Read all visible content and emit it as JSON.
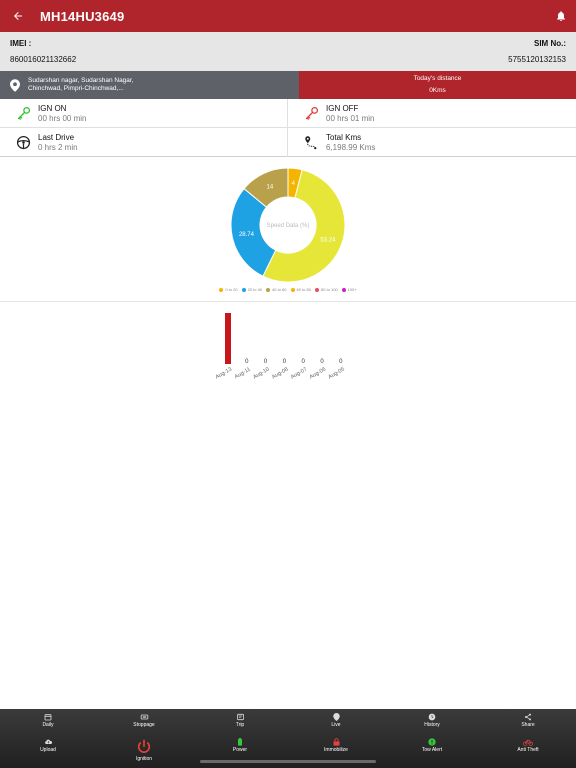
{
  "header": {
    "title": "MH14HU3649",
    "back_icon": "arrow-left-icon",
    "bell_icon": "bell-icon"
  },
  "device": {
    "imei_label": "IMEI :",
    "imei_value": "860016021132662",
    "sim_label": "SIM No.:",
    "sim_value": "5755120132153"
  },
  "location": {
    "address_line1": "Sudarshan nagar, Sudarshan Nagar,",
    "address_line2": "Chinchwad, Pimpri-Chinchwad,...",
    "distance_label": "Today's distance",
    "distance_value": "0Kms"
  },
  "stats": {
    "ign_on": {
      "label": "IGN ON",
      "value": "00 hrs 00 min"
    },
    "ign_off": {
      "label": "IGN OFF",
      "value": "00 hrs 01 min"
    },
    "last_drive": {
      "label": "Last Drive",
      "value": "0 hrs 2 min"
    },
    "total_kms": {
      "label": "Total Kms",
      "value": "6,198.99 Kms"
    }
  },
  "colors": {
    "brand_red": "#b0242b",
    "ign_on_green": "#2fc02f",
    "ign_off_red": "#e03b3b"
  },
  "chart_data": [
    {
      "type": "pie",
      "center_label": "Speed Data (%)",
      "slices": [
        {
          "name": "0 to 20",
          "value": 4,
          "label": "4",
          "color": "#f4b400"
        },
        {
          "name": "20 to 40",
          "value": 53.24,
          "label": "53.24",
          "color": "#e6e639"
        },
        {
          "name": "40 to 60",
          "value": 28.74,
          "label": "28.74",
          "color": "#1fa2e4"
        },
        {
          "name": "60 to 80",
          "value": 14,
          "label": "14",
          "color": "#b8a14a"
        },
        {
          "name": "80 to 100",
          "value": 0,
          "label": "",
          "color": "#e84f5c"
        },
        {
          "name": "100+",
          "value": 0,
          "label": "",
          "color": "#c81ec8"
        }
      ],
      "legend": [
        {
          "name": "0 to 20",
          "color": "#f4b400"
        },
        {
          "name": "20 to 40",
          "color": "#1fa2e4"
        },
        {
          "name": "40 to 60",
          "color": "#b8a14a"
        },
        {
          "name": "60 to 80",
          "color": "#f4b400"
        },
        {
          "name": "80 to 100",
          "color": "#e84f5c"
        },
        {
          "name": "100+",
          "color": "#c81ec8"
        }
      ]
    },
    {
      "type": "bar",
      "categories": [
        "Aug-13",
        "Aug-11",
        "Aug-10",
        "Aug-08",
        "Aug-07",
        "Aug-06",
        "Aug-05"
      ],
      "values": [
        0.5,
        0,
        0,
        0,
        0,
        0,
        0
      ],
      "value_labels": [
        "",
        "0",
        "0",
        "0",
        "0",
        "0",
        "0"
      ],
      "ylim": [
        0,
        0.5
      ],
      "bar_color": "#c8161d"
    }
  ],
  "bottom_nav": {
    "row1": [
      {
        "label": "Daily",
        "icon": "calendar-icon"
      },
      {
        "label": "Stoppage",
        "icon": "stoppage-icon"
      },
      {
        "label": "Trip",
        "icon": "trip-icon"
      },
      {
        "label": "Live",
        "icon": "map-pin-icon"
      },
      {
        "label": "History",
        "icon": "history-icon"
      },
      {
        "label": "Share",
        "icon": "share-icon"
      }
    ],
    "row2": [
      {
        "label": "Upload",
        "icon": "cloud-upload-icon"
      },
      {
        "label": "Ignition",
        "icon": "power-icon"
      },
      {
        "label": "Power",
        "icon": "battery-icon"
      },
      {
        "label": "Immobilize",
        "icon": "lock-icon"
      },
      {
        "label": "Tow Alert",
        "icon": "tow-alert-icon"
      },
      {
        "label": "Anti Theft",
        "icon": "anti-theft-icon"
      }
    ]
  }
}
